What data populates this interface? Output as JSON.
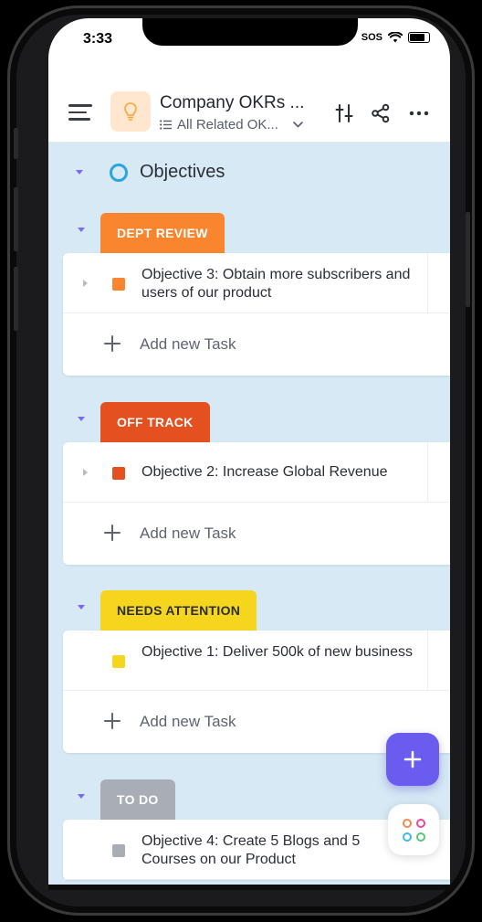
{
  "status_bar": {
    "time": "3:33",
    "sos": "SOS"
  },
  "header": {
    "title": "Company OKRs ...",
    "subtitle": "All Related OK...",
    "icons": [
      "menu-icon",
      "lightbulb-icon",
      "filter-icon",
      "share-icon",
      "more-icon"
    ]
  },
  "objectives": {
    "label": "Objectives"
  },
  "groups": [
    {
      "status": "DEPT REVIEW",
      "color": "#f9862e",
      "tasks": [
        {
          "name": "Objective 3: Obtain more subscribers and users of our product",
          "color": "#f9862e"
        }
      ],
      "add_label": "Add new Task"
    },
    {
      "status": "OFF TRACK",
      "color": "#e4501f",
      "tasks": [
        {
          "name": "Objective 2: Increase Global Revenue",
          "color": "#e4501f"
        }
      ],
      "add_label": "Add new Task"
    },
    {
      "status": "NEEDS ATTENTION",
      "color": "#f5d51e",
      "tasks": [
        {
          "name": "Objective 1: Deliver 500k of new business",
          "color": "#f5d51e"
        }
      ],
      "add_label": "Add new Task"
    },
    {
      "status": "TO DO",
      "color": "#a9aeb6",
      "tasks": [
        {
          "name": "Objective 4: Create 5 Blogs and 5 Courses on our Product",
          "color": "#a9aeb6"
        }
      ],
      "add_label": ""
    }
  ],
  "colors": {
    "accent": "#6b5cf0",
    "background": "#d6e9f5",
    "ring": "#2ba4e0"
  }
}
